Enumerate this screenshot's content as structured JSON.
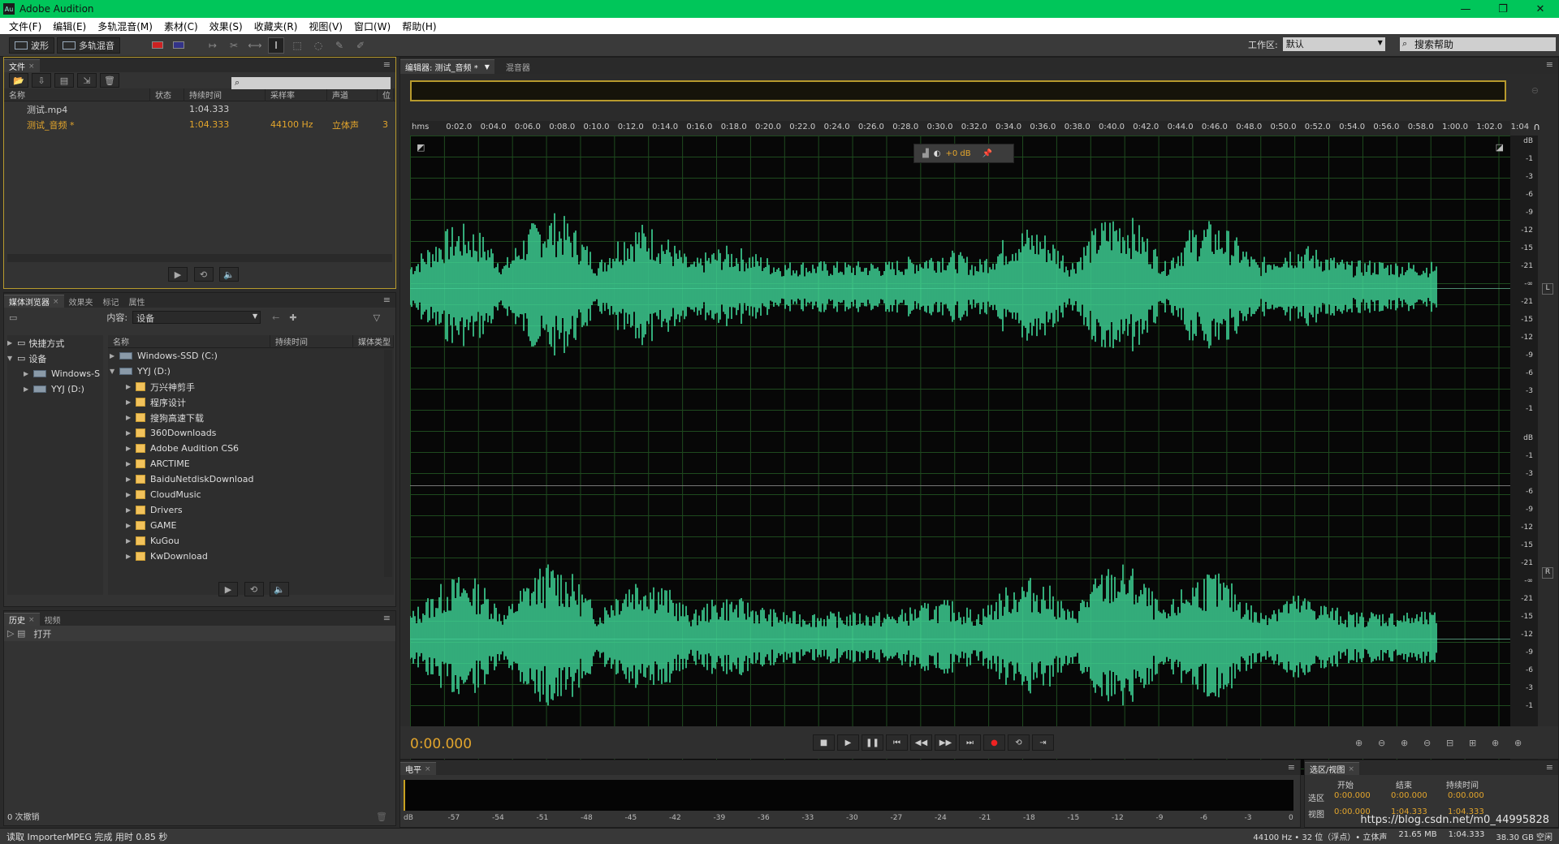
{
  "window": {
    "title": "Adobe Audition",
    "icon": "Au"
  },
  "menu": [
    "文件(F)",
    "编辑(E)",
    "多轨混音(M)",
    "素材(C)",
    "效果(S)",
    "收藏夹(R)",
    "视图(V)",
    "窗口(W)",
    "帮助(H)"
  ],
  "toolbar": {
    "waveform": "波形",
    "multitrack": "多轨混音",
    "workspace_label": "工作区:",
    "workspace_value": "默认",
    "help_search": "搜索帮助"
  },
  "files": {
    "tab": "文件",
    "columns": [
      "名称",
      "状态",
      "持续时间",
      "采样率",
      "声道",
      "位"
    ],
    "rows": [
      {
        "name": "测试.mp4",
        "status": "",
        "duration": "1:04.333",
        "rate": "",
        "channels": "",
        "bits": ""
      },
      {
        "name": "测试_音频 *",
        "status": "",
        "duration": "1:04.333",
        "rate": "44100 Hz",
        "channels": "立体声",
        "bits": "3"
      }
    ]
  },
  "media": {
    "tabs": [
      "媒体浏览器",
      "效果夹",
      "标记",
      "属性"
    ],
    "content_label": "内容:",
    "content_value": "设备",
    "left_tree": [
      {
        "label": "快捷方式",
        "level": 0
      },
      {
        "label": "设备",
        "level": 0
      },
      {
        "label": "Windows-S",
        "level": 1
      },
      {
        "label": "YYJ (D:)",
        "level": 1
      }
    ],
    "columns": [
      "名称",
      "持续时间",
      "媒体类型"
    ],
    "right_tree": [
      {
        "label": "Windows-SSD (C:)",
        "kind": "drive"
      },
      {
        "label": "YYJ (D:)",
        "kind": "drive"
      },
      {
        "label": "万兴神剪手",
        "kind": "folder"
      },
      {
        "label": "程序设计",
        "kind": "folder"
      },
      {
        "label": "搜狗高速下载",
        "kind": "folder"
      },
      {
        "label": "360Downloads",
        "kind": "folder"
      },
      {
        "label": "Adobe Audition CS6",
        "kind": "folder"
      },
      {
        "label": "ARCTIME",
        "kind": "folder"
      },
      {
        "label": "BaiduNetdiskDownload",
        "kind": "folder"
      },
      {
        "label": "CloudMusic",
        "kind": "folder"
      },
      {
        "label": "Drivers",
        "kind": "folder"
      },
      {
        "label": "GAME",
        "kind": "folder"
      },
      {
        "label": "KuGou",
        "kind": "folder"
      },
      {
        "label": "KwDownload",
        "kind": "folder"
      }
    ]
  },
  "history": {
    "tabs": [
      "历史",
      "视频"
    ],
    "items": [
      "打开"
    ],
    "undo_count": "0 次撤销"
  },
  "editor": {
    "tab_label": "编辑器: 测试_音频 *",
    "mixer_tab": "混音器",
    "ruler": [
      "hms",
      "0:02.0",
      "0:04.0",
      "0:06.0",
      "0:08.0",
      "0:10.0",
      "0:12.0",
      "0:14.0",
      "0:16.0",
      "0:18.0",
      "0:20.0",
      "0:22.0",
      "0:24.0",
      "0:26.0",
      "0:28.0",
      "0:30.0",
      "0:32.0",
      "0:34.0",
      "0:36.0",
      "0:38.0",
      "0:40.0",
      "0:42.0",
      "0:44.0",
      "0:46.0",
      "0:48.0",
      "0:50.0",
      "0:52.0",
      "0:54.0",
      "0:56.0",
      "0:58.0",
      "1:00.0",
      "1:02.0",
      "1:04"
    ],
    "hud_gain": "+0 dB",
    "db_scale_top": [
      "dB",
      "-1",
      "-3",
      "-6",
      "-9",
      "-12",
      "-15",
      "-21",
      "-∞",
      "-21",
      "-15",
      "-12",
      "-9",
      "-6",
      "-3",
      "-1"
    ],
    "db_scale_bottom": [
      "dB",
      "-1",
      "-3",
      "-6",
      "-9",
      "-12",
      "-15",
      "-21",
      "-∞",
      "-21",
      "-15",
      "-12",
      "-9",
      "-6",
      "-3",
      "-1"
    ],
    "channel_left": "L",
    "channel_right": "R",
    "time": "0:00.000",
    "wave_color": "#3fd597"
  },
  "levels": {
    "tab": "电平",
    "scale": [
      "dB",
      "-57",
      "-54",
      "-51",
      "-48",
      "-45",
      "-42",
      "-39",
      "-36",
      "-33",
      "-30",
      "-27",
      "-24",
      "-21",
      "-18",
      "-15",
      "-12",
      "-9",
      "-6",
      "-3",
      "0"
    ]
  },
  "selview": {
    "tab": "选区/视图",
    "cols": [
      "开始",
      "结束",
      "持续时间"
    ],
    "sel_label": "选区",
    "sel": [
      "0:00.000",
      "0:00.000",
      "0:00.000"
    ],
    "view_label": "视图",
    "view": [
      "0:00.000",
      "1:04.333",
      "1:04.333"
    ]
  },
  "status": {
    "left": "读取 ImporterMPEG 完成 用时 0.85 秒",
    "right": [
      "44100 Hz • 32 位（浮点）• 立体声",
      "21.65 MB",
      "1:04.333",
      "38.30 GB 空闲"
    ],
    "watermark": "https://blog.csdn.net/m0_44995828"
  }
}
